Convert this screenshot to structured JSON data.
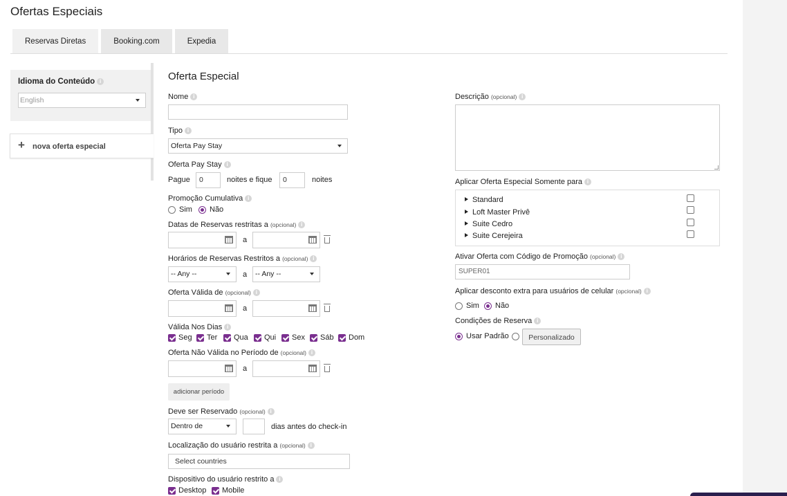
{
  "page_title": "Ofertas Especiais",
  "tabs": [
    {
      "label": "Reservas Diretas"
    },
    {
      "label": "Booking.com"
    },
    {
      "label": "Expedia"
    }
  ],
  "sidebar": {
    "language_label": "Idioma do Conteúdo",
    "language_value": "English",
    "new_offer_label": "nova oferta especial"
  },
  "form": {
    "section_title": "Oferta Especial",
    "optional": "(opcional)",
    "name_label": "Nome",
    "name_value": "",
    "type_label": "Tipo",
    "type_value": "Oferta Pay Stay",
    "pay_stay_label": "Oferta Pay Stay",
    "pay_label": "Pague",
    "pay_value": "0",
    "stay_label": "noites e fique",
    "stay_value": "0",
    "nights_label": "noites",
    "cumulative_label": "Promoção Cumulativa",
    "yes": "Sim",
    "no": "Não",
    "sep_a": "a",
    "booking_dates_label": "Datas de Reservas restritas a",
    "booking_hours_label": "Horários de Reservas Restritos a",
    "hours_from": "-- Any --",
    "hours_to": "-- Any --",
    "valid_from_label": "Oferta Válida de",
    "valid_days_label": "Válida Nos Dias",
    "days": [
      {
        "label": "Seg",
        "checked": true
      },
      {
        "label": "Ter",
        "checked": true
      },
      {
        "label": "Qua",
        "checked": true
      },
      {
        "label": "Qui",
        "checked": true
      },
      {
        "label": "Sex",
        "checked": true
      },
      {
        "label": "Sáb",
        "checked": true
      },
      {
        "label": "Dom",
        "checked": true
      }
    ],
    "not_valid_label": "Oferta Não Válida no Período de",
    "add_period_button": "adicionar período",
    "must_book_label": "Deve ser Reservado",
    "must_book_value": "Dentro de",
    "days_before_value": "",
    "days_before_label": "dias antes do check-in",
    "location_label": "Localização do usuário restrita a",
    "location_placeholder": "Select countries",
    "device_label": "Dispositivo do usuário restrito a",
    "devices": [
      {
        "label": "Desktop",
        "checked": true
      },
      {
        "label": "Mobile",
        "checked": true
      }
    ]
  },
  "right": {
    "description_label": "Descrição",
    "apply_only_label": "Aplicar Oferta Especial Somente para",
    "rooms": [
      {
        "label": "Standard",
        "checked": false
      },
      {
        "label": "Loft Master Privê",
        "checked": false
      },
      {
        "label": "Suite Cedro",
        "checked": false
      },
      {
        "label": "Suite Cerejeira",
        "checked": false
      }
    ],
    "promo_code_label": "Ativar Oferta com Código de Promoção",
    "promo_code_value": "SUPER01",
    "mobile_discount_label": "Aplicar desconto extra para usuários de celular",
    "booking_conditions_label": "Condições de Reserva",
    "use_default_label": "Usar Padrão",
    "custom_button": "Personalizado"
  },
  "colors": {
    "accent": "#7a2f8f",
    "corner": "#2a1f4e"
  }
}
